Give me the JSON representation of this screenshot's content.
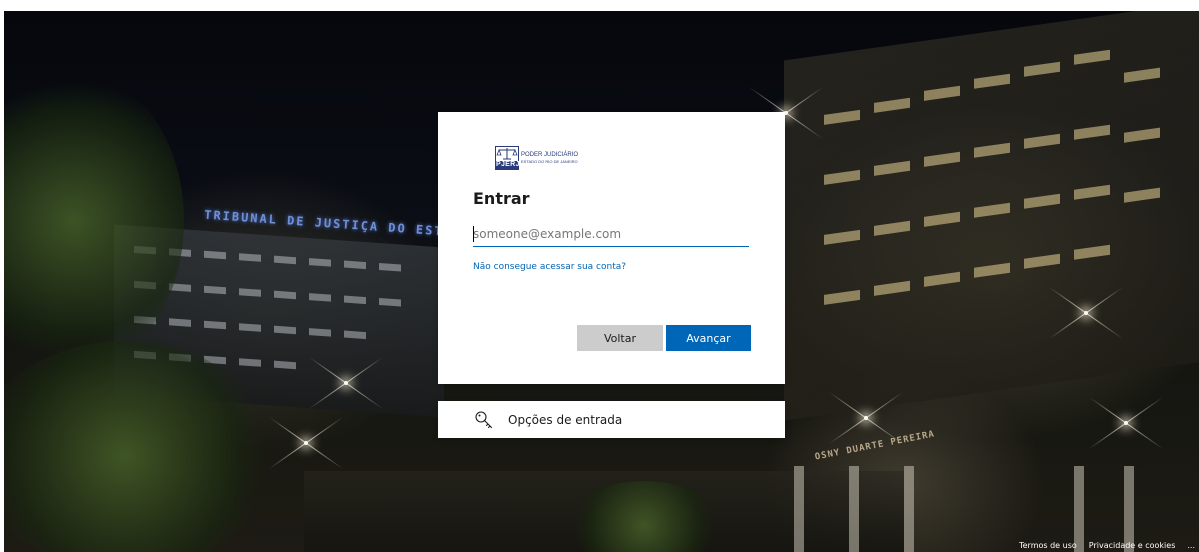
{
  "logo": {
    "abbr": "PJERJ",
    "line1": "PODER JUDICIÁRIO",
    "line2": "ESTADO DO RIO DE JANEIRO"
  },
  "signin": {
    "title": "Entrar",
    "email_placeholder": "someone@example.com",
    "email_value": "",
    "help_link": "Não consegue acessar sua conta?",
    "back_label": "Voltar",
    "next_label": "Avançar"
  },
  "signin_options": {
    "label": "Opções de entrada",
    "icon": "key-icon"
  },
  "background": {
    "sign_left": "TRIBUNAL DE JUSTIÇA DO EST",
    "sign_right": "OSNY DUARTE PEREIRA"
  },
  "footer": {
    "terms": "Termos de uso",
    "privacy": "Privacidade e cookies",
    "more": "..."
  },
  "colors": {
    "accent": "#0067b8",
    "back_button": "#cccccc",
    "brand": "#2a3a7a"
  }
}
